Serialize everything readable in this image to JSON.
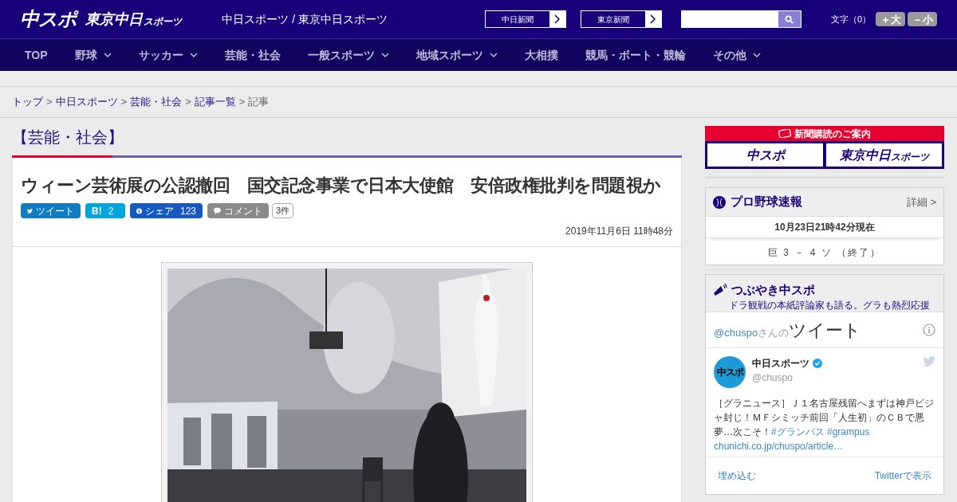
{
  "header": {
    "logo_main": "中スポ",
    "logo_sub": "東京中日",
    "logo_sub_small": "スポーツ",
    "site_title": "中日スポーツ / 東京中日スポーツ",
    "paper_links": [
      "中日新聞",
      "東京新聞"
    ],
    "font_size": {
      "label": "文字（0）",
      "buttons": [
        "＋大",
        "－小"
      ]
    }
  },
  "nav": [
    {
      "label": "TOP",
      "dropdown": false
    },
    {
      "label": "野球",
      "dropdown": true
    },
    {
      "label": "サッカー",
      "dropdown": true
    },
    {
      "label": "芸能・社会",
      "dropdown": false
    },
    {
      "label": "一般スポーツ",
      "dropdown": true
    },
    {
      "label": "地域スポーツ",
      "dropdown": true
    },
    {
      "label": "大相撲",
      "dropdown": false
    },
    {
      "label": "競馬・ボート・競輪",
      "dropdown": false
    },
    {
      "label": "その他",
      "dropdown": true
    }
  ],
  "breadcrumb_separator": ">",
  "breadcrumb": [
    {
      "label": "トップ",
      "link": true
    },
    {
      "label": "中日スポーツ",
      "link": true
    },
    {
      "label": "芸能・社会",
      "link": true
    },
    {
      "label": "記事一覧",
      "link": true
    },
    {
      "label": "記事",
      "link": false
    }
  ],
  "section_title": "【芸能・社会】",
  "article": {
    "title": "ウィーン芸術展の公認撤回　国交記念事業で日本大使館　安倍政権批判を問題視か",
    "share": [
      {
        "kind": "twitter",
        "label": "ツイート"
      },
      {
        "kind": "hatena",
        "label": "B!",
        "count": "2"
      },
      {
        "kind": "facebook",
        "label": "シェア",
        "count": "123"
      },
      {
        "kind": "comment",
        "label": "コメント",
        "count": "3件"
      }
    ],
    "date": "2019年11月6日 11時48分"
  },
  "sidebar": {
    "subscribe": {
      "title": "新聞購読のご案内",
      "logos": [
        {
          "main": "中スポ"
        },
        {
          "main": "東京中日",
          "small": "スポーツ"
        }
      ]
    },
    "baseball": {
      "title": "プロ野球速報",
      "more": "詳細 >",
      "updated": "10月23日21時42分現在",
      "score": "巨 3 － 4 ソ （終了）"
    },
    "tweets": {
      "title": "つぶやき中スポ",
      "subtitle": "ドラ観戦の本紙評論家も語る。グラも熱烈応援",
      "handle": "@chuspo",
      "handle_suffix": "さんの",
      "heading": "ツイート",
      "account_name": "中日スポーツ",
      "account_handle": "@chuspo",
      "avatar_text": "中スポ",
      "text": "［グラニュース］Ｊ１名古屋残留へまずは神戸ビジャ封じ！ＭＦシミッチ前回「人生初」のＣＢで悪夢…次こそ！",
      "hashtags": [
        "#グランパス",
        "#grampus"
      ],
      "link": "chunichi.co.jp/chuspo/article…",
      "embed": "埋め込む",
      "view": "Twitterで表示"
    }
  }
}
